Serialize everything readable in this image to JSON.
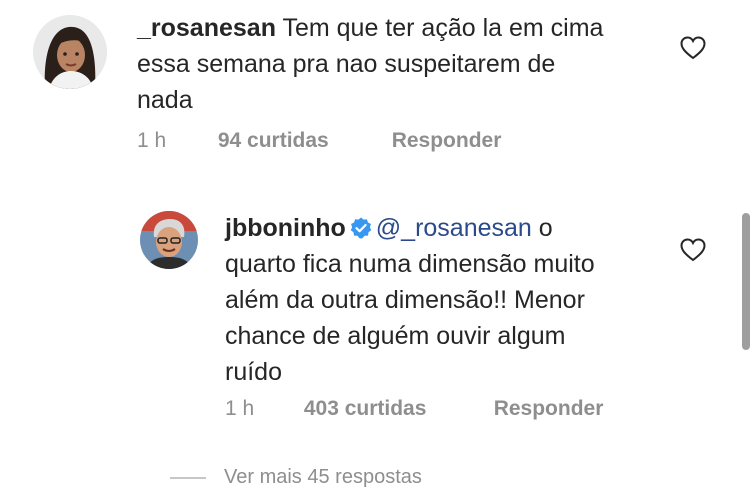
{
  "comments": [
    {
      "username": "_rosanesan",
      "text": "Tem que ter ação la em cima essa semana pra nao suspeitarem de nada",
      "time": "1 h",
      "likes": "94 curtidas",
      "reply": "Responder",
      "verified": false,
      "avatar_icon": "user-avatar-photo"
    },
    {
      "username": "jbboninho",
      "mention": "@_rosanesan",
      "text": " o quarto fica numa dimensão muito além da outra dimensão!! Menor chance de alguém ouvir algum ruído",
      "time": "1 h",
      "likes": "403 curtidas",
      "reply": "Responder",
      "verified": true,
      "avatar_icon": "user-avatar-photo"
    }
  ],
  "view_more": "Ver mais 45 respostas",
  "colors": {
    "text": "#262626",
    "meta": "#8e8e8e",
    "mention": "#2a4a8b",
    "verified": "#3897f0"
  },
  "icons": {
    "like": "heart-outline-icon",
    "verified": "verified-badge-icon"
  }
}
